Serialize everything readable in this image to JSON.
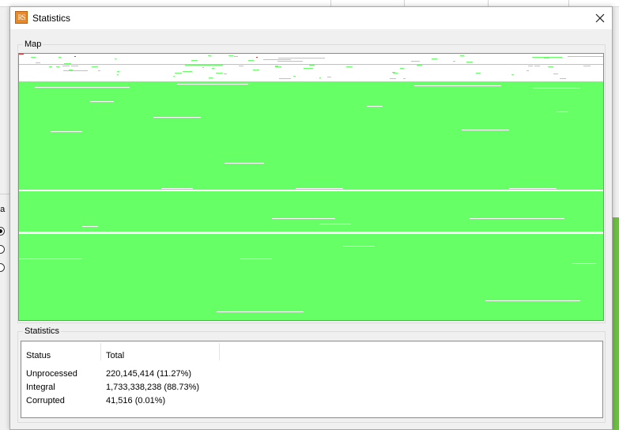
{
  "window": {
    "title": "Statistics",
    "icon_text": "RS"
  },
  "background": {
    "partial_label": "na"
  },
  "map": {
    "label": "Map",
    "colors": {
      "integral": "#66ff66",
      "unprocessed": "#ffffff",
      "corrupted": "#d03030"
    }
  },
  "statistics": {
    "label": "Statistics",
    "columns": [
      "Status",
      "Total"
    ],
    "rows": [
      {
        "status": "Unprocessed",
        "total": "220,145,414 (11.27%)"
      },
      {
        "status": "Integral",
        "total": "1,733,338,238 (88.73%)"
      },
      {
        "status": "Corrupted",
        "total": "41,516 (0.01%)"
      }
    ]
  }
}
